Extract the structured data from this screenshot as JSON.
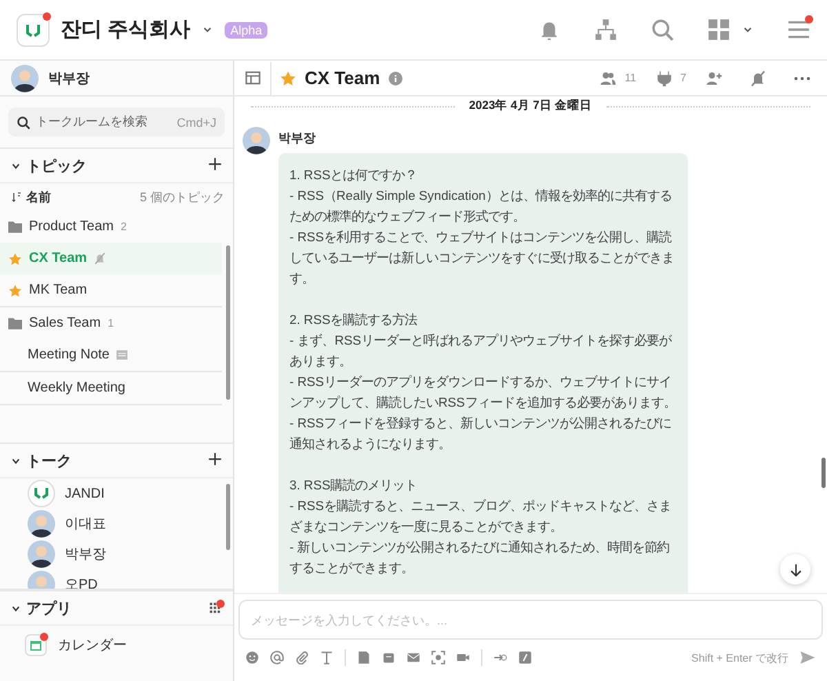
{
  "workspace": {
    "name": "잔디 주식회사",
    "badge": "Alpha",
    "logo_notification": true,
    "menu_notification": true
  },
  "user": {
    "name": "박부장"
  },
  "search": {
    "placeholder": "トークルームを検索",
    "shortcut": "Cmd+J"
  },
  "topics": {
    "title": "トピック",
    "expanded": true,
    "sort_label": "名前",
    "count": "5 個のトピック",
    "groups": [
      {
        "items": [
          {
            "label": "Product Team",
            "kind": "folder",
            "count": "2",
            "selected": false
          },
          {
            "label": "CX Team",
            "kind": "favorite",
            "muted": true,
            "selected": true
          },
          {
            "label": "MK Team",
            "kind": "favorite",
            "selected": false
          }
        ]
      },
      {
        "items": [
          {
            "label": "Sales Team",
            "kind": "folder",
            "count": "1",
            "selected": false
          },
          {
            "label": "Meeting Note",
            "kind": "note",
            "selected": false
          }
        ]
      },
      {
        "items": [
          {
            "label": "Weekly Meeting",
            "kind": "plain",
            "selected": false
          }
        ]
      }
    ]
  },
  "talks": {
    "title": "トーク",
    "expanded": true,
    "items": [
      {
        "name": "JANDI",
        "kind": "logo"
      },
      {
        "name": "이대표",
        "kind": "person"
      },
      {
        "name": "박부장",
        "kind": "person"
      },
      {
        "name": "오PD",
        "kind": "person"
      }
    ]
  },
  "apps": {
    "title": "アプリ",
    "expanded": true,
    "notification": true,
    "items": [
      {
        "label": "カレンダー",
        "notification": true
      }
    ]
  },
  "channel": {
    "title": "CX Team",
    "favorite": true,
    "members": "11",
    "integrations": "7"
  },
  "date": "2023年 4月 7日 金曜日",
  "message": {
    "sender": "박부장",
    "sections": [
      {
        "paragraphs": [
          "1. RSSとは何ですか？",
          "- RSS（Really Simple Syndication）とは、情報を効率的に共有するための標準的なウェブフィード形式です。",
          "- RSSを利用することで、ウェブサイトはコンテンツを公開し、購読しているユーザーは新しいコンテンツをすぐに受け取ることができます。"
        ]
      },
      {
        "paragraphs": [
          "2. RSSを購読する方法",
          "- まず、RSSリーダーと呼ばれるアプリやウェブサイトを探す必要があります。",
          "- RSSリーダーのアプリをダウンロードするか、ウェブサイトにサインアップして、購読したいRSSフィードを追加する必要があります。",
          "- RSSフィードを登録すると、新しいコンテンツが公開されるたびに通知されるようになります。"
        ]
      },
      {
        "paragraphs": [
          "3. RSS購読のメリット",
          "- RSSを購読すると、ニュース、ブログ、ポッドキャストなど、さまざまなコンテンツを一度に見ることができます。",
          "- 新しいコンテンツが公開されるたびに通知されるため、時間を節約することができます。"
        ]
      }
    ]
  },
  "composer": {
    "placeholder": "メッセージを入力してください。...",
    "hint": "Shift + Enter で改行"
  }
}
